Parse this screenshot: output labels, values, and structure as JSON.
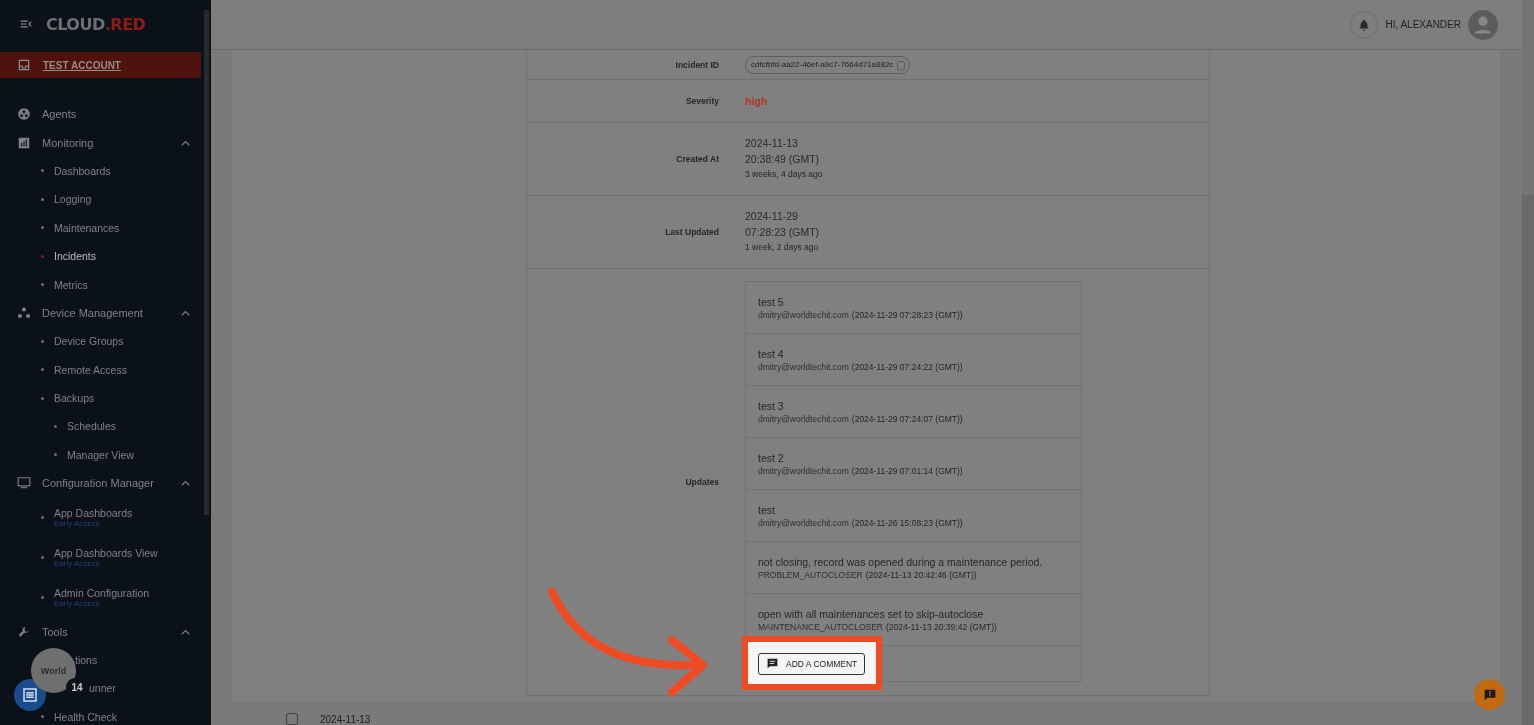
{
  "sidebar": {
    "logo": "CLOUD.RED",
    "account": "TEST ACCOUNT",
    "items": [
      {
        "label": "Agents"
      },
      {
        "label": "Monitoring",
        "expanded": true,
        "children": [
          {
            "label": "Dashboards",
            "selected": false
          },
          {
            "label": "Logging",
            "selected": false
          },
          {
            "label": "Maintenances",
            "selected": false
          },
          {
            "label": "Incidents",
            "selected": true
          },
          {
            "label": "Metrics",
            "selected": false
          }
        ]
      },
      {
        "label": "Device Management",
        "expanded": true,
        "children": [
          {
            "label": "Device Groups",
            "selected": false
          },
          {
            "label": "Remote Access",
            "selected": false
          },
          {
            "label": "Backups",
            "selected": false,
            "children": [
              {
                "label": "Schedules",
                "selected": false
              },
              {
                "label": "Manager View",
                "selected": false
              }
            ]
          }
        ]
      },
      {
        "label": "Configuration Manager",
        "expanded": true,
        "children": [
          {
            "label": "App Dashboards",
            "note": "Early Access",
            "selected": false
          },
          {
            "label": "App Dashboards View",
            "note": "Early Access",
            "selected": false
          },
          {
            "label": "Admin Configuration",
            "note": "Early Access",
            "selected": false
          }
        ]
      },
      {
        "label": "Tools",
        "expanded": true,
        "children": [
          {
            "label": "tions",
            "covered": true,
            "selected": false
          },
          {
            "label": "unner",
            "covered": true,
            "selected": false
          },
          {
            "label": "Health Check",
            "selected": false
          }
        ]
      }
    ]
  },
  "widgets": {
    "logo_bubble": "World",
    "badge": "14"
  },
  "header": {
    "greeting": "HI, ALEXANDER"
  },
  "details": [
    {
      "label": "Incident ID",
      "kind": "chip",
      "value": "cdfcfbfd-aa22-46ef-a9c7-7664d71a882c"
    },
    {
      "label": "Severity",
      "kind": "severity",
      "value": "high"
    },
    {
      "label": "Created At",
      "kind": "date",
      "date": "2024-11-13",
      "time": "20:38:49 (GMT)",
      "ago": "3 weeks, 4 days ago"
    },
    {
      "label": "Last Updated",
      "kind": "date",
      "date": "2024-11-29",
      "time": "07:28:23 (GMT)",
      "ago": "1 week, 2 days ago"
    },
    {
      "label": "Updates",
      "kind": "updates"
    }
  ],
  "updates": [
    {
      "text": "test 5",
      "author": "dmitry@worldtechit.com",
      "time": "(2024-11-29 07:28:23 (GMT))"
    },
    {
      "text": "test 4",
      "author": "dmitry@worldtechit.com",
      "time": "(2024-11-29 07:24:22 (GMT))"
    },
    {
      "text": "test 3",
      "author": "dmitry@worldtechit.com",
      "time": "(2024-11-29 07:24:07 (GMT))"
    },
    {
      "text": "test 2",
      "author": "dmitry@worldtechit.com",
      "time": "(2024-11-29 07:01:14 (GMT))"
    },
    {
      "text": "test",
      "author": "dmitry@worldtechit.com",
      "time": "(2024-11-26 15:08:23 (GMT))"
    },
    {
      "text": "not closing, record was opened during a maintenance period.",
      "author": "PROBLEM_AUTOCLOSER",
      "time": "(2024-11-13 20:42:46 (GMT))"
    },
    {
      "text": "open with all maintenances set to skip-autoclose",
      "author": "MAINTENANCE_AUTOCLOSER",
      "time": "(2024-11-13 20:39:42 (GMT))"
    }
  ],
  "add_comment": "ADD A COMMENT",
  "next_row": {
    "checked": false,
    "date": "2024-11-13"
  }
}
